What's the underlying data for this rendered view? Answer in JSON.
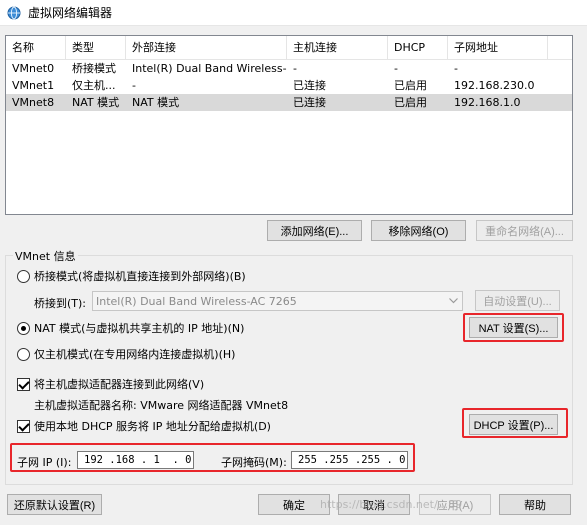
{
  "window": {
    "title": "虚拟网络编辑器",
    "icon": "network-globe-icon"
  },
  "network_table": {
    "columns": [
      "名称",
      "类型",
      "外部连接",
      "主机连接",
      "DHCP",
      "子网地址"
    ],
    "rows": [
      {
        "name": "VMnet0",
        "type": "桥接模式",
        "external": "Intel(R) Dual Band Wireless-...",
        "host": "-",
        "dhcp": "-",
        "subnet": "-"
      },
      {
        "name": "VMnet1",
        "type": "仅主机...",
        "external": "-",
        "host": "已连接",
        "dhcp": "已启用",
        "subnet": "192.168.230.0"
      },
      {
        "name": "VMnet8",
        "type": "NAT 模式",
        "external": "NAT 模式",
        "host": "已连接",
        "dhcp": "已启用",
        "subnet": "192.168.1.0"
      }
    ],
    "selected_row": "VMnet8"
  },
  "list_buttons": {
    "add": "添加网络(E)...",
    "remove": "移除网络(O)",
    "rename": "重命名网络(A)..."
  },
  "vmnet_info": {
    "group_title": "VMnet 信息",
    "bridged_option": "桥接模式(将虚拟机直接连接到外部网络)(B)",
    "bridged_to_label": "桥接到(T):",
    "bridged_to_value": "Intel(R) Dual Band Wireless-AC 7265",
    "auto_settings": "自动设置(U)...",
    "nat_option": "NAT 模式(与虚拟机共享主机的 IP 地址)(N)",
    "nat_settings": "NAT 设置(S)...",
    "hostonly_option": "仅主机模式(在专用网络内连接虚拟机)(H)",
    "selected_mode": "nat",
    "connect_adapter": "将主机虚拟适配器连接到此网络(V)",
    "connect_adapter_checked": true,
    "adapter_name": "主机虚拟适配器名称: VMware 网络适配器 VMnet8",
    "use_dhcp": "使用本地 DHCP 服务将 IP 地址分配给虚拟机(D)",
    "use_dhcp_checked": true,
    "dhcp_settings": "DHCP 设置(P)...",
    "subnet_ip_label": "子网 IP (I):",
    "subnet_ip_value": "192 .168 . 1  . 0",
    "subnet_mask_label": "子网掩码(M):",
    "subnet_mask_value": "255 .255 .255 . 0"
  },
  "footer": {
    "restore": "还原默认设置(R)",
    "ok": "确定",
    "cancel": "取消",
    "apply": "应用(A)",
    "help": "帮助"
  },
  "watermark": "https://blog.csdn.net/...89"
}
